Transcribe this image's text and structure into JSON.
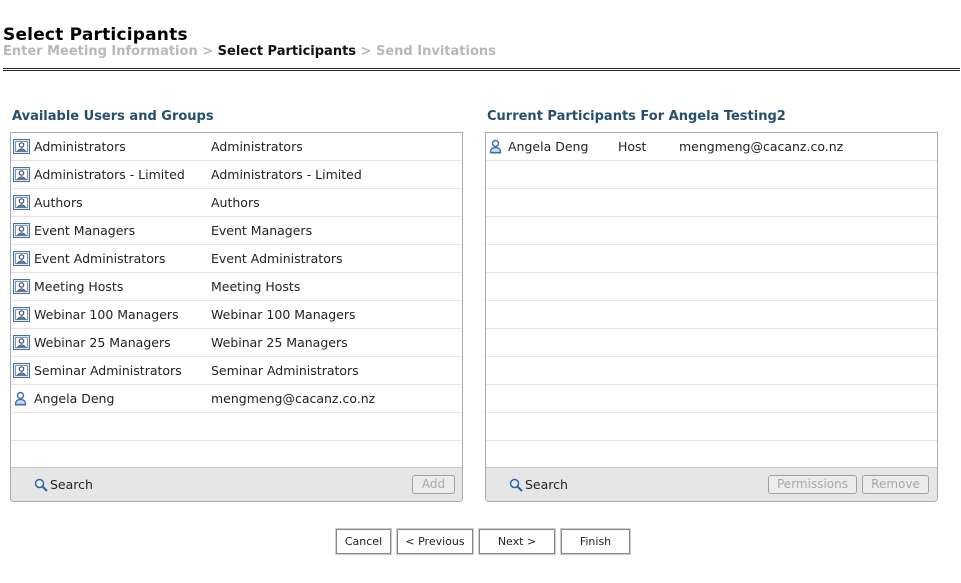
{
  "header": {
    "title": "Select Participants",
    "breadcrumb": {
      "step1": "Enter Meeting Information",
      "sep1": " > ",
      "step2": "Select Participants",
      "sep2": " > ",
      "step3": "Send Invitations"
    }
  },
  "available": {
    "title": "Available Users and Groups",
    "rows": [
      {
        "icon": "group-icon",
        "name": "Administrators",
        "detail": "Administrators"
      },
      {
        "icon": "group-icon",
        "name": "Administrators - Limited",
        "detail": "Administrators - Limited"
      },
      {
        "icon": "group-icon",
        "name": "Authors",
        "detail": "Authors"
      },
      {
        "icon": "group-icon",
        "name": "Event Managers",
        "detail": "Event Managers"
      },
      {
        "icon": "group-icon",
        "name": "Event Administrators",
        "detail": "Event Administrators"
      },
      {
        "icon": "group-icon",
        "name": "Meeting Hosts",
        "detail": "Meeting Hosts"
      },
      {
        "icon": "group-icon",
        "name": "Webinar 100 Managers",
        "detail": "Webinar 100 Managers"
      },
      {
        "icon": "group-icon",
        "name": "Webinar 25 Managers",
        "detail": "Webinar 25 Managers"
      },
      {
        "icon": "group-icon",
        "name": "Seminar Administrators",
        "detail": "Seminar Administrators"
      },
      {
        "icon": "user-icon",
        "name": "Angela Deng",
        "detail": "mengmeng@cacanz.co.nz"
      }
    ],
    "search_label": "Search",
    "add_label": "Add"
  },
  "participants": {
    "title": "Current Participants For Angela Testing2",
    "rows": [
      {
        "icon": "user-icon",
        "name": "Angela Deng",
        "role": "Host",
        "email": "mengmeng@cacanz.co.nz"
      }
    ],
    "search_label": "Search",
    "permissions_label": "Permissions",
    "remove_label": "Remove"
  },
  "nav": {
    "cancel": "Cancel",
    "previous": "< Previous",
    "next": "Next >",
    "finish": "Finish"
  },
  "colors": {
    "panel_title": "#274f6b",
    "breadcrumb_inactive": "#b8b8b8",
    "footer_bg": "#e6e6e6",
    "icon_blue": "#3d6fb0"
  }
}
